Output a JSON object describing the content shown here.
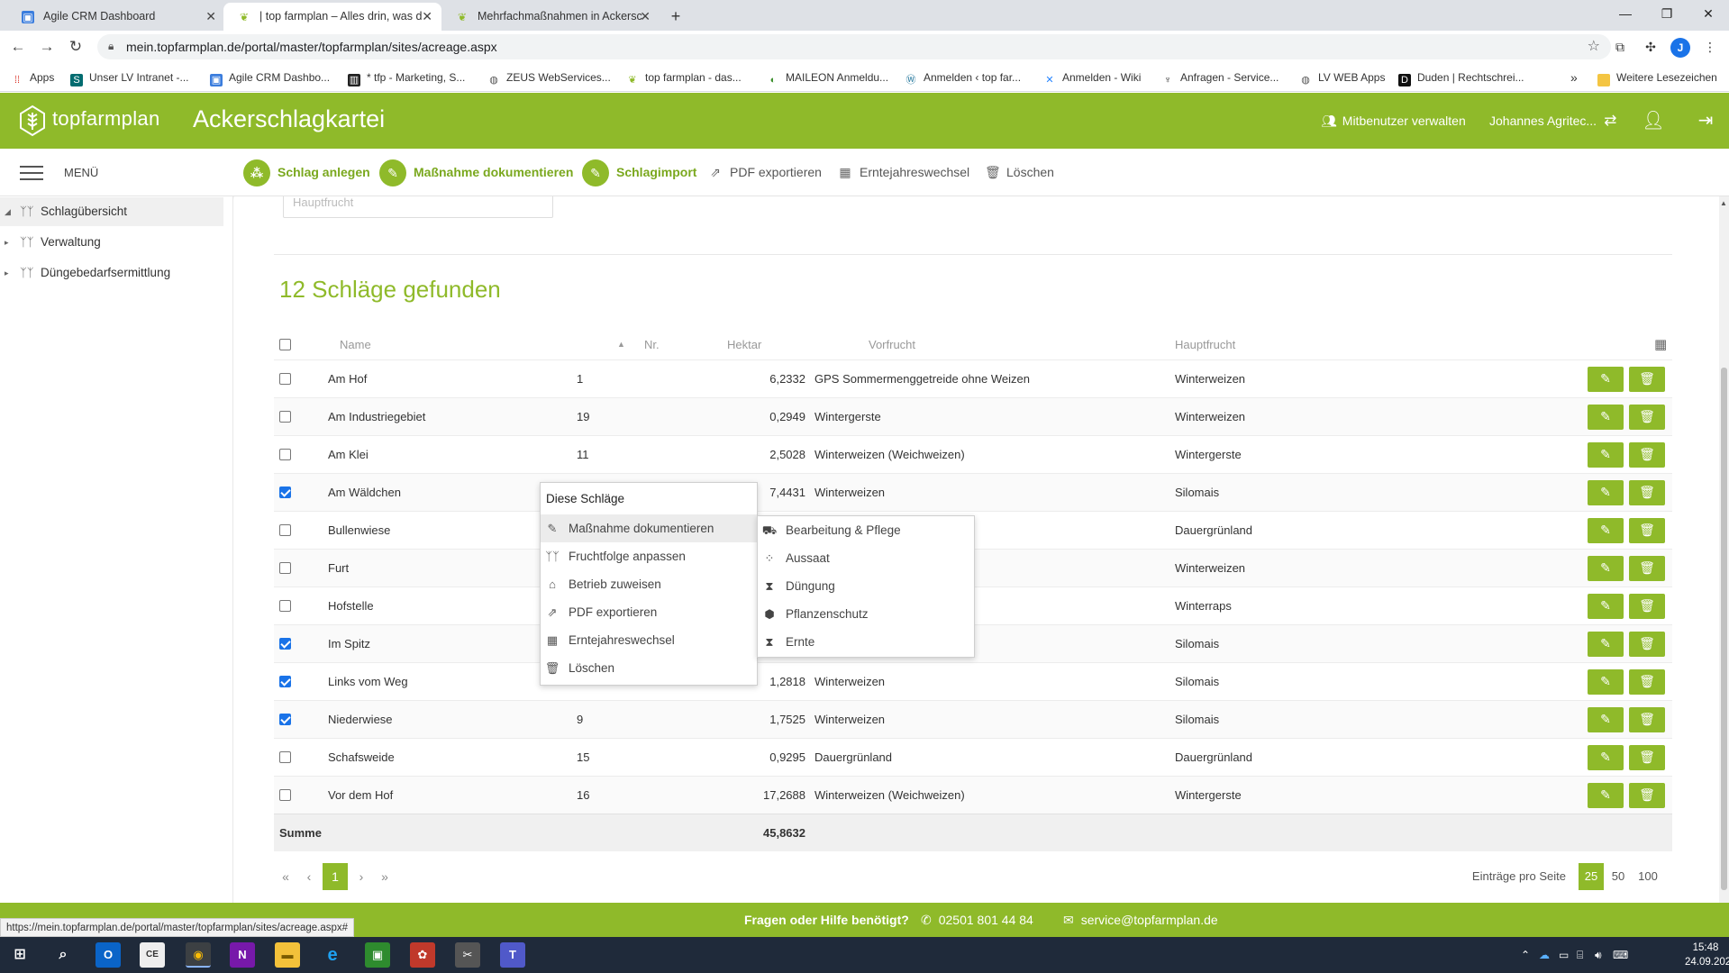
{
  "browser": {
    "tabs": [
      {
        "title": "Agile CRM Dashboard",
        "active": false
      },
      {
        "title": "| top farmplan – Alles drin, was d",
        "active": true
      },
      {
        "title": "Mehrfachmaßnahmen in Ackersc",
        "active": false
      }
    ],
    "url": "mein.topfarmplan.de/portal/master/topfarmplan/sites/acreage.aspx",
    "profile_initial": "J",
    "bookmarks": [
      "Apps",
      "Unser LV Intranet -...",
      "Agile CRM Dashbo...",
      "* tfp - Marketing, S...",
      "ZEUS WebServices...",
      "top farmplan - das...",
      "MAILEON Anmeldu...",
      "Anmelden ‹ top far...",
      "Anmelden - Wiki",
      "Anfragen - Service...",
      "LV WEB Apps",
      "Duden | Rechtschrei..."
    ],
    "bookmarks_more": "»",
    "bookmarks_folder": "Weitere Lesezeichen"
  },
  "header": {
    "logo_text": "topfarmplan",
    "title": "Ackerschlagkartei",
    "manage_users": "Mitbenutzer verwalten",
    "user": "Johannes Agritec..."
  },
  "toolbar": {
    "menu_label": "MENÜ",
    "btn_create": "Schlag anlegen",
    "btn_document": "Maßnahme dokumentieren",
    "btn_import": "Schlagimport",
    "btn_pdf": "PDF exportieren",
    "btn_year": "Erntejahreswechsel",
    "btn_delete": "Löschen"
  },
  "sidebar": {
    "items": [
      "Schlagübersicht",
      "Verwaltung",
      "Düngebedarfsermittlung"
    ]
  },
  "main": {
    "search_placeholder": "Hauptfrucht",
    "found_text": "12 Schläge gefunden",
    "columns": [
      "Name",
      "Nr.",
      "Hektar",
      "Vorfrucht",
      "Hauptfrucht"
    ],
    "rows": [
      {
        "name": "Am Hof",
        "nr": "1",
        "ha": "6,2332",
        "vor": "GPS Sommermenggetreide ohne Weizen",
        "haupt": "Winterweizen",
        "checked": false
      },
      {
        "name": "Am Industriegebiet",
        "nr": "19",
        "ha": "0,2949",
        "vor": "Wintergerste",
        "haupt": "Winterweizen",
        "checked": false
      },
      {
        "name": "Am Klei",
        "nr": "11",
        "ha": "2,5028",
        "vor": "Winterweizen (Weichweizen)",
        "haupt": "Wintergerste",
        "checked": false
      },
      {
        "name": "Am Wäldchen",
        "nr": "",
        "ha": "7,4431",
        "vor": "Winterweizen",
        "haupt": "Silomais",
        "checked": true
      },
      {
        "name": "Bullenwiese",
        "nr": "",
        "ha": "",
        "vor": "",
        "haupt": "Dauergrünland",
        "checked": false
      },
      {
        "name": "Furt",
        "nr": "",
        "ha": "",
        "vor": "",
        "haupt": "Winterweizen",
        "checked": false
      },
      {
        "name": "Hofstelle",
        "nr": "",
        "ha": "",
        "vor": "weizen)",
        "haupt": "Winterraps",
        "checked": false
      },
      {
        "name": "Im Spitz",
        "nr": "",
        "ha": "",
        "vor": "",
        "haupt": "Silomais",
        "checked": true
      },
      {
        "name": "Links vom Weg",
        "nr": "",
        "ha": "1,2818",
        "vor": "Winterweizen",
        "haupt": "Silomais",
        "checked": true
      },
      {
        "name": "Niederwiese",
        "nr": "9",
        "ha": "1,7525",
        "vor": "Winterweizen",
        "haupt": "Silomais",
        "checked": true
      },
      {
        "name": "Schafsweide",
        "nr": "15",
        "ha": "0,9295",
        "vor": "Dauergrünland",
        "haupt": "Dauergrünland",
        "checked": false
      },
      {
        "name": "Vor dem Hof",
        "nr": "16",
        "ha": "17,2688",
        "vor": "Winterweizen (Weichweizen)",
        "haupt": "Wintergerste",
        "checked": false
      }
    ],
    "sum_label": "Summe",
    "sum_value": "45,8632",
    "pager": {
      "first": "«",
      "prev": "‹",
      "current": "1",
      "next": "›",
      "last": "»"
    },
    "entries_label": "Einträge pro Seite",
    "page_sizes": [
      "25",
      "50",
      "100"
    ],
    "page_size_selected": "25"
  },
  "context_menu": {
    "title": "Diese Schläge",
    "items": [
      "Maßnahme dokumentieren",
      "Fruchtfolge anpassen",
      "Betrieb zuweisen",
      "PDF exportieren",
      "Erntejahreswechsel",
      "Löschen"
    ]
  },
  "submenu": {
    "items": [
      "Bearbeitung & Pflege",
      "Aussaat",
      "Düngung",
      "Pflanzenschutz",
      "Ernte"
    ]
  },
  "footer": {
    "help": "Fragen oder Hilfe benötigt?",
    "phone": "02501 801 44 84",
    "email": "service@topfarmplan.de"
  },
  "status_url": "https://mein.topfarmplan.de/portal/master/topfarmplan/sites/acreage.aspx#",
  "taskbar": {
    "time": "15:48",
    "date": "24.09.2020",
    "notification_count": "7"
  },
  "colors": {
    "brand": "#8fba2a",
    "brand_text": "#7aa81e",
    "checkbox": "#1a73e8"
  }
}
